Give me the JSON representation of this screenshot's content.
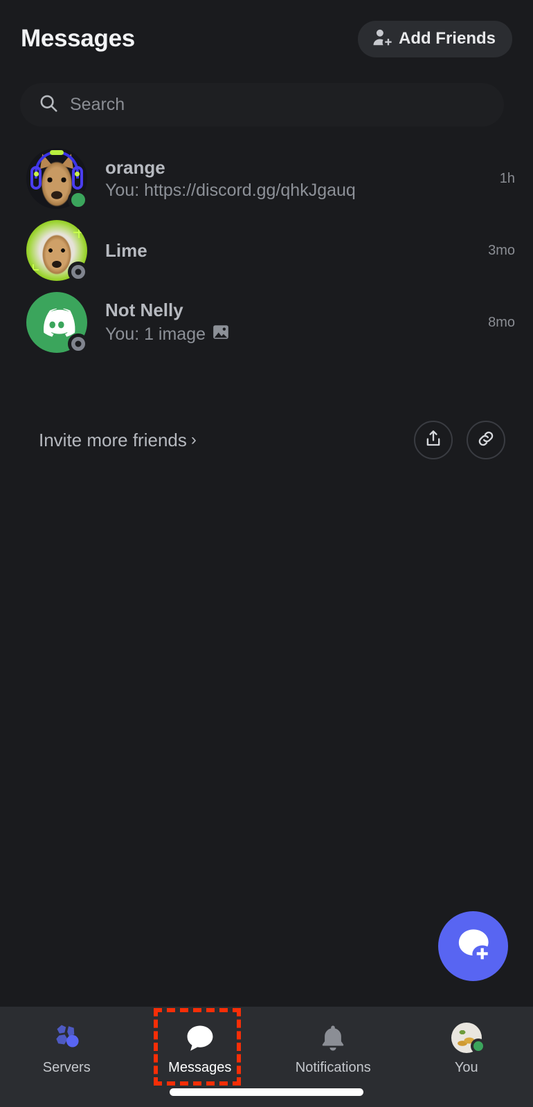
{
  "header": {
    "title": "Messages",
    "add_friends_label": "Add Friends",
    "add_friends_icon": "person-plus-icon"
  },
  "search": {
    "placeholder": "Search",
    "value": "",
    "icon": "search-icon"
  },
  "conversations": [
    {
      "name": "orange",
      "preview": "You: https://discord.gg/qhkJgauq",
      "timestamp": "1h",
      "status": "online",
      "avatar": "dog-with-neon-headphones-avatar",
      "attachment_icon": ""
    },
    {
      "name": "Lime",
      "preview": "",
      "timestamp": "3mo",
      "status": "offline",
      "avatar": "dog-lime-glow-avatar",
      "attachment_icon": ""
    },
    {
      "name": "Not Nelly",
      "preview": "You: 1 image",
      "timestamp": "8mo",
      "status": "offline",
      "avatar": "discord-clyde-green-avatar",
      "attachment_icon": "image-icon"
    }
  ],
  "invite": {
    "label": "Invite more friends",
    "chevron": "›",
    "share_icon": "share-icon",
    "link_icon": "link-icon"
  },
  "fab": {
    "icon": "new-message-icon"
  },
  "bottom_nav": {
    "items": [
      {
        "label": "Servers",
        "icon": "servers-icon",
        "active": false
      },
      {
        "label": "Messages",
        "icon": "messages-bubble-icon",
        "active": true
      },
      {
        "label": "Notifications",
        "icon": "bell-icon",
        "active": false
      },
      {
        "label": "You",
        "icon": "user-avatar-icon",
        "active": false
      }
    ]
  },
  "colors": {
    "background": "#1a1b1e",
    "nav_background": "#2b2d31",
    "accent_blurple": "#5865f2",
    "online_green": "#3ba55c",
    "offline_gray": "#80848e",
    "annotation_red": "#f82e07"
  }
}
